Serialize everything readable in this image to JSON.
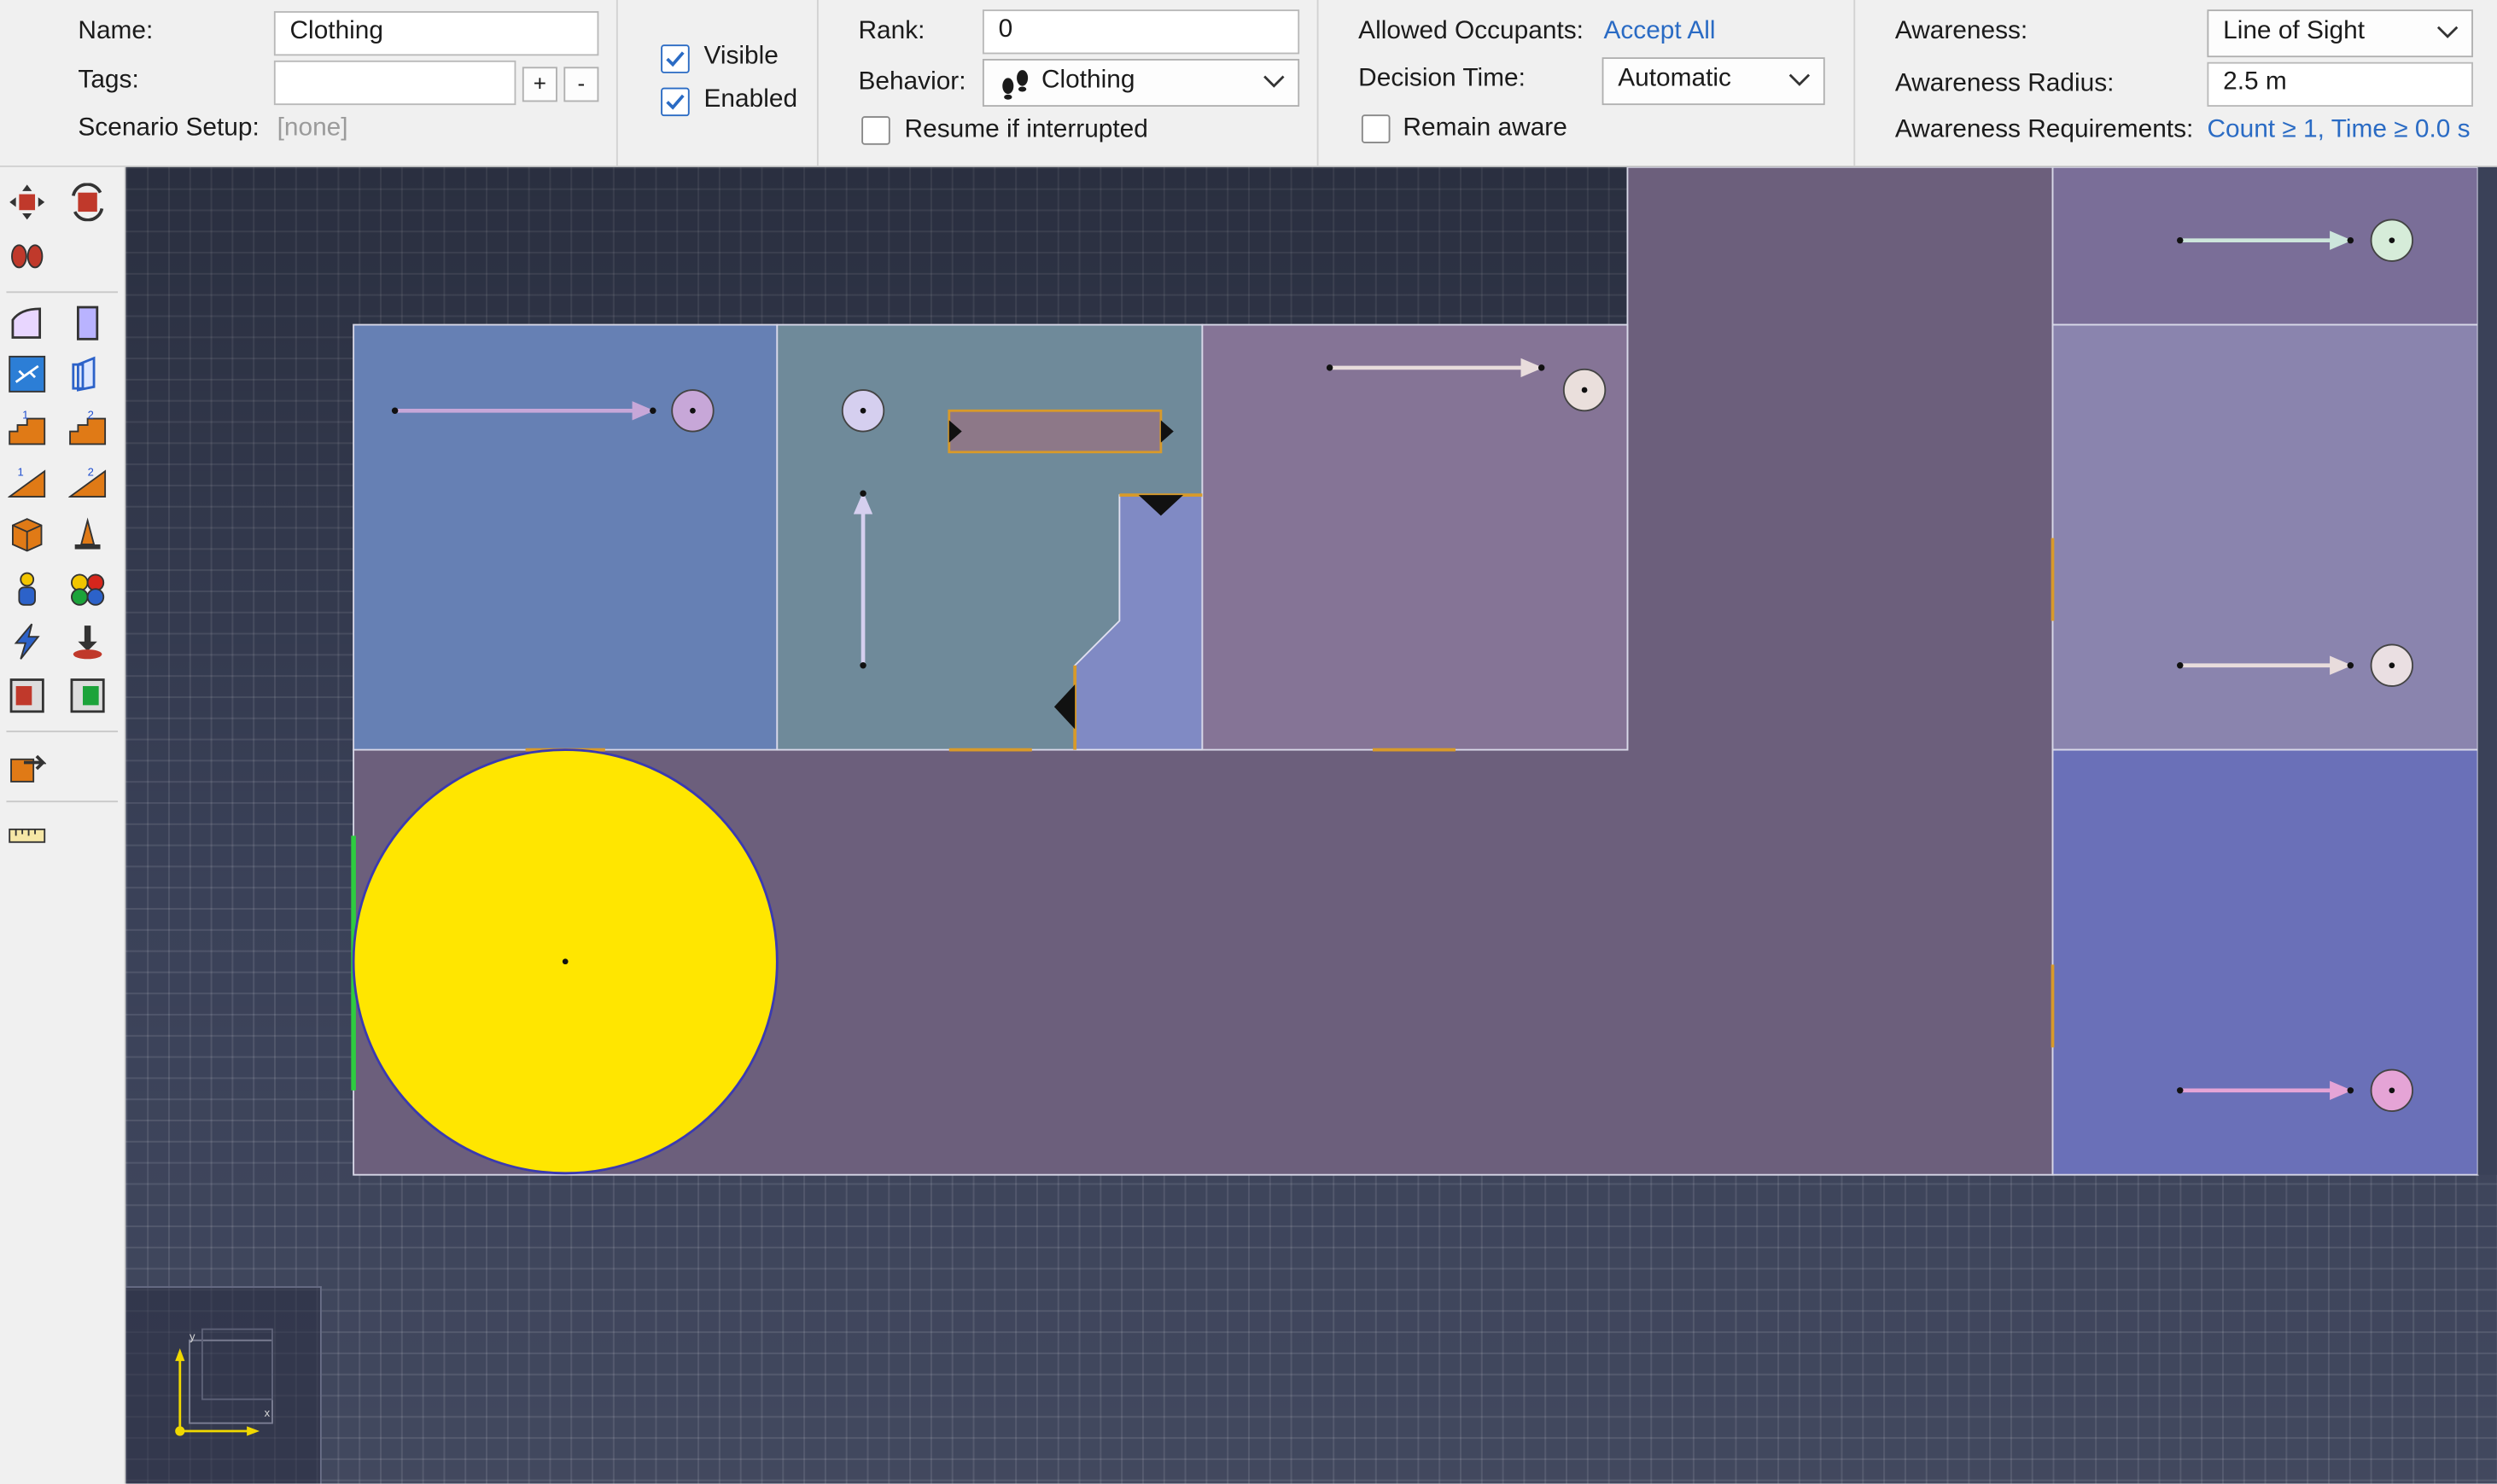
{
  "properties": {
    "name_label": "Name:",
    "name_value": "Clothing",
    "tags_label": "Tags:",
    "tags_value": "",
    "tags_add": "+",
    "tags_remove": "-",
    "scenario_label": "Scenario Setup:",
    "scenario_value": "[none]",
    "visible_label": "Visible",
    "visible_checked": true,
    "enabled_label": "Enabled",
    "enabled_checked": true,
    "rank_label": "Rank:",
    "rank_value": "0",
    "behavior_label": "Behavior:",
    "behavior_value": "Clothing",
    "resume_label": "Resume if interrupted",
    "resume_checked": false,
    "allowed_label": "Allowed Occupants:",
    "allowed_value": "Accept All",
    "decision_label": "Decision Time:",
    "decision_value": "Automatic",
    "remain_label": "Remain aware",
    "remain_checked": false,
    "awareness_label": "Awareness:",
    "awareness_value": "Line of Sight",
    "radius_label": "Awareness Radius:",
    "radius_value": "2.5 m",
    "requirements_label": "Awareness Requirements:",
    "requirements_value": "Count ≥ 1, Time ≥ 0.0 s"
  },
  "toolbar": {
    "tools": [
      "move-tool-icon",
      "rotate-tool-icon",
      "footprints-tool-icon",
      "room-tool-icon",
      "wall-tool-icon",
      "stair-tool-icon",
      "door-tool-icon",
      "ramp-up-tool-icon",
      "ramp-down-tool-icon",
      "escalator-up-tool-icon",
      "escalator-down-tool-icon",
      "obstruction-tool-icon",
      "cone-tool-icon",
      "occupant-tool-icon",
      "group-tool-icon",
      "lightning-tool-icon",
      "target-tool-icon",
      "region-tool-icon",
      "exit-region-tool-icon",
      "export-tool-icon",
      "measure-tool-icon"
    ]
  },
  "viewport": {
    "axis_x": "x",
    "axis_y": "y",
    "colors": {
      "outer_room": "#6c5f7c",
      "room_blue": "#6680b4",
      "room_teal": "#6f8a9a",
      "room_mauve": "#857496",
      "room_right_mid": "#8a84ae",
      "room_right_bottom": "#6a70b8",
      "yellow_region": "#ffe600"
    }
  }
}
